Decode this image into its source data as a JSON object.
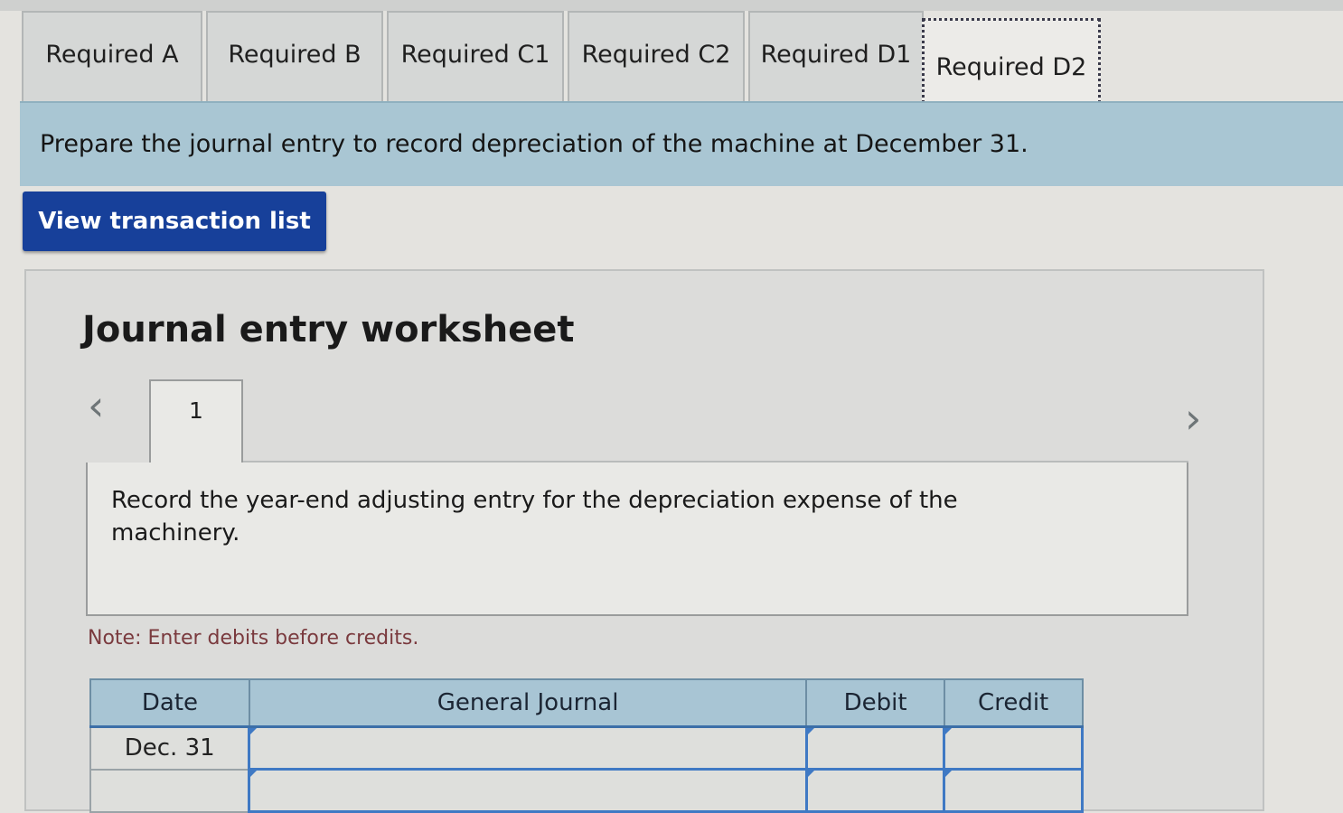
{
  "tabs": [
    {
      "label": "Required A",
      "active": false
    },
    {
      "label": "Required B",
      "active": false
    },
    {
      "label": "Required C1",
      "active": false
    },
    {
      "label": "Required C2",
      "active": false
    },
    {
      "label": "Required D1",
      "active": false
    },
    {
      "label": "Required D2",
      "active": true
    }
  ],
  "instruction": "Prepare the journal entry to record depreciation of the machine at December 31.",
  "view_transaction_button": "View transaction list",
  "worksheet": {
    "title": "Journal entry worksheet",
    "nav_prev_icon": "chevron-left-icon",
    "nav_next_icon": "chevron-right-icon",
    "current_step": "1",
    "description": "Record the year-end adjusting entry for the depreciation expense of the machinery.",
    "note": "Note: Enter debits before credits."
  },
  "journal_table": {
    "headers": [
      "Date",
      "General Journal",
      "Debit",
      "Credit"
    ],
    "rows": [
      {
        "date": "Dec. 31",
        "account": "",
        "debit": "",
        "credit": ""
      },
      {
        "date": "",
        "account": "",
        "debit": "",
        "credit": ""
      }
    ]
  },
  "colors": {
    "instruction_band": "#a9c6d3",
    "button_bg": "#17409a",
    "table_header": "#a8c5d4",
    "input_border": "#3f79c4",
    "note_text": "#7a3a3e"
  }
}
